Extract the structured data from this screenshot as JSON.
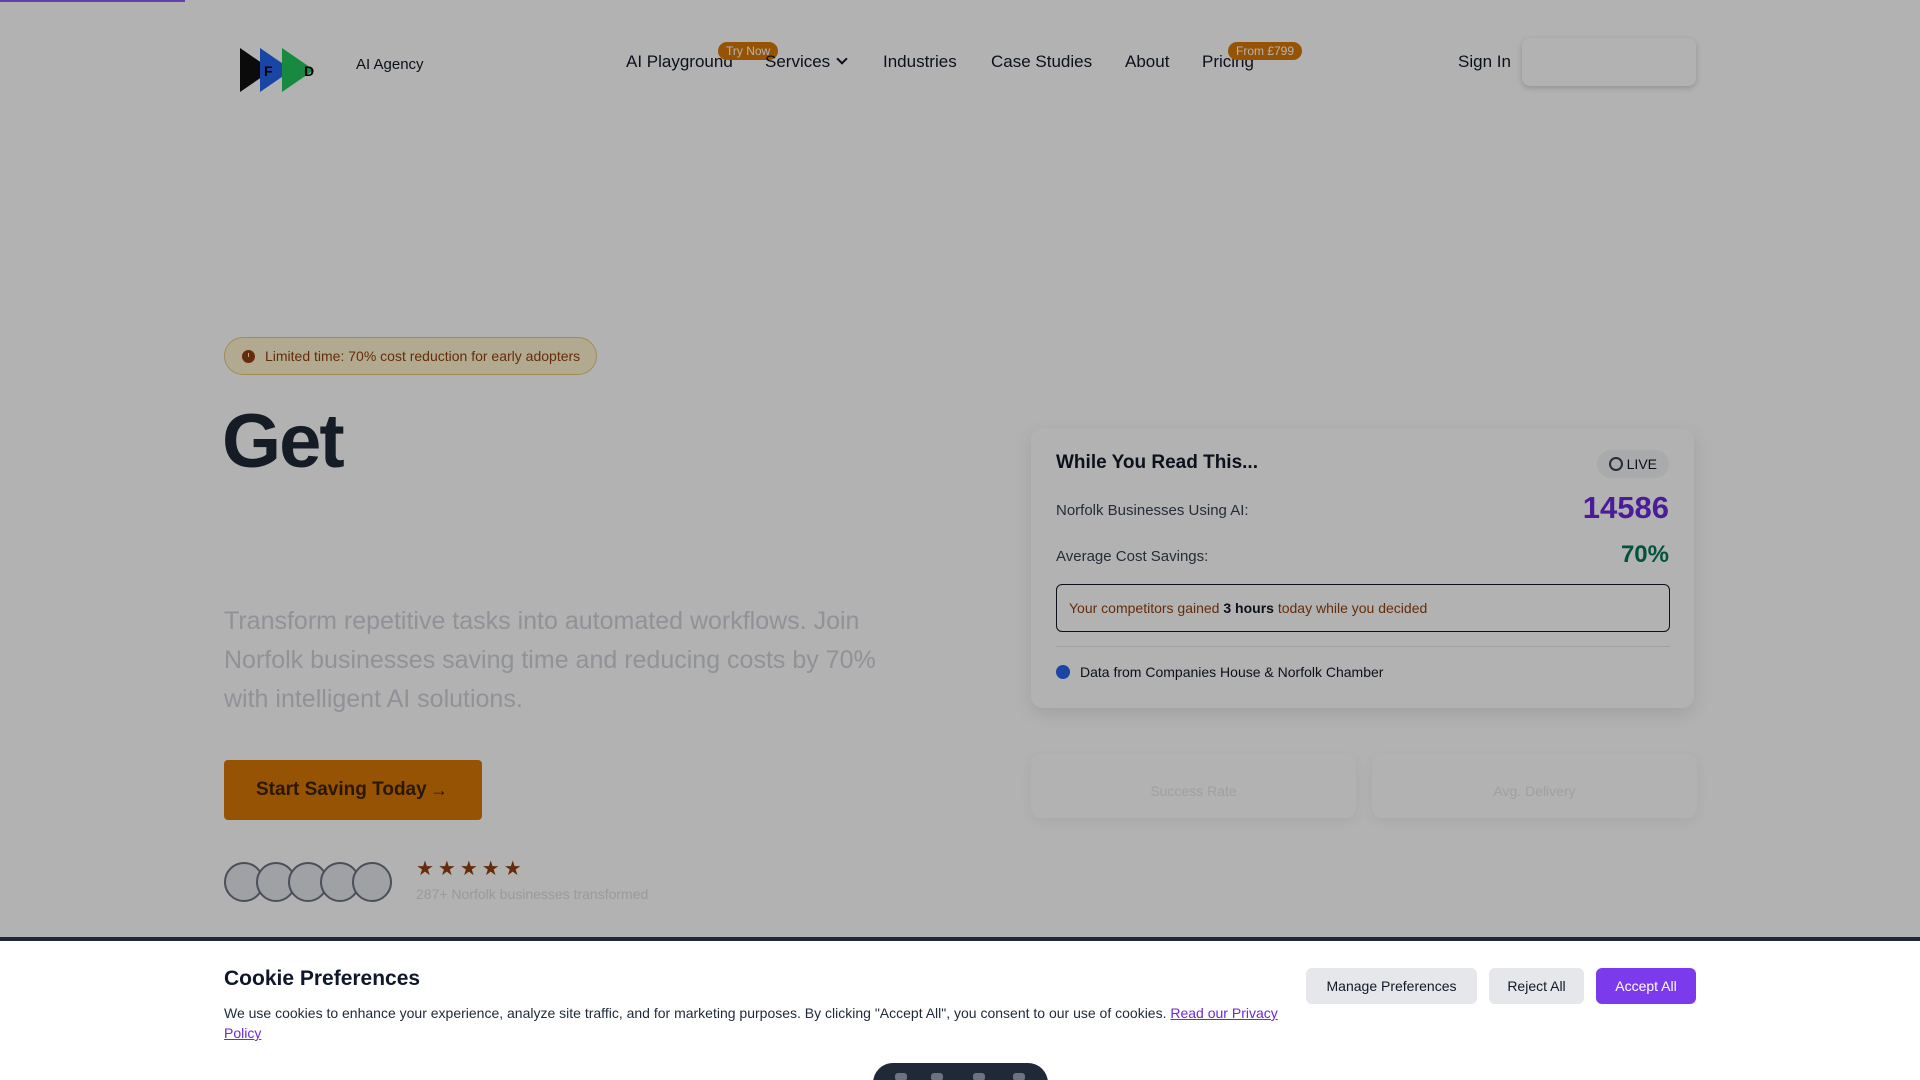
{
  "header": {
    "brand_tagline": "AI Agency",
    "logo_letters": [
      "F",
      "D"
    ],
    "nav": [
      {
        "label": "AI Playground",
        "badge": "Try Now"
      },
      {
        "label": "Services",
        "has_dropdown": true
      },
      {
        "label": "Industries"
      },
      {
        "label": "Case Studies"
      },
      {
        "label": "About"
      },
      {
        "label": "Pricing",
        "badge": "From £799"
      }
    ],
    "sign_in": "Sign In"
  },
  "hero": {
    "promo": "Limited time: 70% cost reduction for early adopters",
    "title": "Get",
    "subtitle": "Transform repetitive tasks into automated workflows. Join Norfolk businesses saving time and reducing costs by 70% with intelligent AI solutions.",
    "cta": "Start Saving Today",
    "stars": "★★★★★",
    "rating_text": "287+ Norfolk businesses transformed"
  },
  "stats_card": {
    "title": "While You Read This...",
    "live_label": "LIVE",
    "rows": [
      {
        "label": "Norfolk Businesses Using AI:",
        "value": "14586"
      },
      {
        "label": "Average Cost Savings:",
        "value": "70%"
      }
    ],
    "alert": {
      "prefix": "Your competitors gained",
      "highlight": "3 hours",
      "suffix": "today while you decided"
    },
    "source": "Data from Companies House & Norfolk Chamber",
    "mini_cards": [
      "Success Rate",
      "Avg. Delivery"
    ]
  },
  "cookie": {
    "title": "Cookie Preferences",
    "text": "We use cookies to enhance your experience, analyze site traffic, and for marketing purposes. By clicking \"Accept All\", you consent to our use of cookies.",
    "link": "Read our Privacy Policy",
    "buttons": {
      "manage": "Manage Preferences",
      "reject": "Reject All",
      "accept": "Accept All"
    }
  },
  "colors": {
    "accent": "#7c3aed",
    "cta": "#d97706",
    "success": "#047857"
  }
}
